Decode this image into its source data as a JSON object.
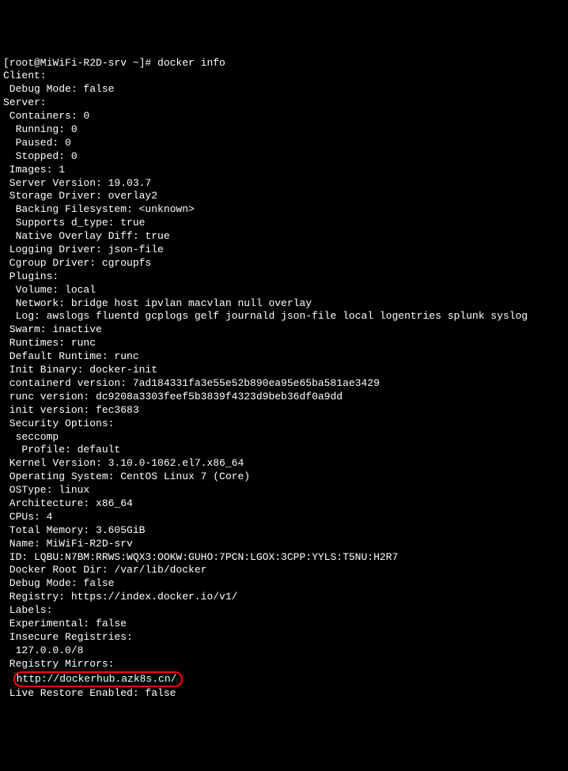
{
  "prompt": "[root@MiWiFi-R2D-srv ~]# docker info",
  "client_header": "Client:",
  "client_debug": " Debug Mode: false",
  "blank1": "",
  "server_header": "Server:",
  "containers": " Containers: 0",
  "running": "  Running: 0",
  "paused": "  Paused: 0",
  "stopped": "  Stopped: 0",
  "images": " Images: 1",
  "server_version": " Server Version: 19.03.7",
  "storage_driver": " Storage Driver: overlay2",
  "backing_fs": "  Backing Filesystem: <unknown>",
  "supports_dtype": "  Supports d_type: true",
  "native_overlay": "  Native Overlay Diff: true",
  "logging_driver": " Logging Driver: json-file",
  "cgroup_driver": " Cgroup Driver: cgroupfs",
  "plugins": " Plugins:",
  "volume": "  Volume: local",
  "network": "  Network: bridge host ipvlan macvlan null overlay",
  "log": "  Log: awslogs fluentd gcplogs gelf journald json-file local logentries splunk syslog",
  "swarm": " Swarm: inactive",
  "runtimes": " Runtimes: runc",
  "default_runtime": " Default Runtime: runc",
  "init_binary": " Init Binary: docker-init",
  "containerd_version": " containerd version: 7ad184331fa3e55e52b890ea95e65ba581ae3429",
  "runc_version": " runc version: dc9208a3303feef5b3839f4323d9beb36df0a9dd",
  "init_version": " init version: fec3683",
  "security_options": " Security Options:",
  "seccomp": "  seccomp",
  "profile": "   Profile: default",
  "kernel_version": " Kernel Version: 3.10.0-1062.el7.x86_64",
  "operating_system": " Operating System: CentOS Linux 7 (Core)",
  "ostype": " OSType: linux",
  "architecture": " Architecture: x86_64",
  "cpus": " CPUs: 4",
  "total_memory": " Total Memory: 3.605GiB",
  "name": " Name: MiWiFi-R2D-srv",
  "id": " ID: LQBU:N7BM:RRWS:WQX3:OOKW:GUHO:7PCN:LGOX:3CPP:YYLS:T5NU:H2R7",
  "docker_root": " Docker Root Dir: /var/lib/docker",
  "debug_mode": " Debug Mode: false",
  "registry": " Registry: https://index.docker.io/v1/",
  "labels": " Labels:",
  "experimental": " Experimental: false",
  "insecure_registries": " Insecure Registries:",
  "insecure_reg_value": "  127.0.0.0/8",
  "registry_mirrors": " Registry Mirrors:",
  "mirror_indent": "  ",
  "mirror_url": "http://dockerhub.azk8s.cn/",
  "live_restore": " Live Restore Enabled: false"
}
